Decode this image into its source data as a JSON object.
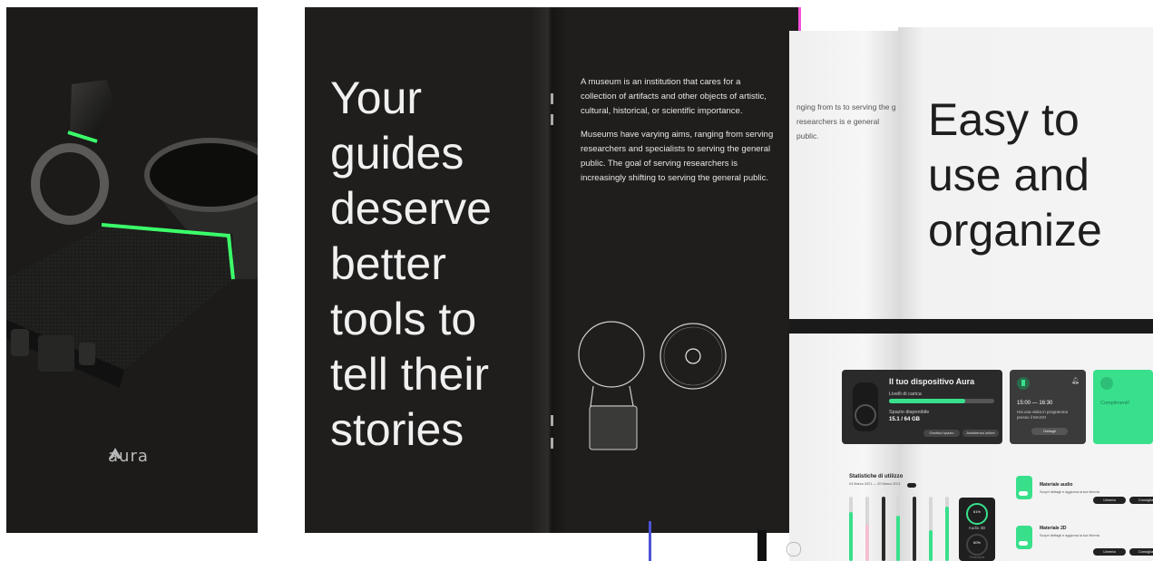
{
  "cover": {
    "logo_text": "aura",
    "accent_color": "#3bff6a"
  },
  "spread": {
    "headline_lines": [
      "Your",
      "guides",
      "deserve",
      "better",
      "tools to",
      "tell their",
      "stories"
    ],
    "paragraph1": "A museum is an institution that cares for a collection of artifacts and other objects of artistic, cultural, historical, or scientific importance.",
    "paragraph2": "Museums have varying aims, ranging from serving researchers and specialists to serving the general public. The goal of serving researchers is increasingly shifting to serving the general public."
  },
  "right": {
    "cut_paragraph": "nging from ts to serving the g researchers is e general public.",
    "headline_lines": [
      "Easy to",
      "use and",
      "organize"
    ],
    "device_card": {
      "title": "Il tuo dispositivo Aura",
      "label1": "Livelli di carica",
      "label2": "Spazio disponibile",
      "storage": "15.1 / 64 GB",
      "button1": "Gestisci spazio",
      "button2": "Assistenza online"
    },
    "schedule_card": {
      "time": "15:00 — 16:30",
      "desc": "Hai una visita in programma presso il MAXXI",
      "button": "Dettagli"
    },
    "green_card": {
      "title": "Complimenti!"
    },
    "stats": {
      "title": "Statistiche di utilizzo",
      "range": "04 Marzo 2021 — 20 Marzo 2021",
      "gauge_value": "61%",
      "gauge_label": "Audio 3D",
      "gauge2_value": "60%",
      "gauge2_label": "Protezione"
    },
    "materials": [
      {
        "title": "Materiale audio",
        "desc": "Scopri dettagli e aggiorna la tua libreria",
        "btn1": "Libreria",
        "btn2": "Consiglia"
      },
      {
        "title": "Materiale 2D",
        "desc": "Scopri dettagli e aggiorna la tua libreria",
        "btn1": "Libreria",
        "btn2": "Consiglia"
      }
    ]
  }
}
